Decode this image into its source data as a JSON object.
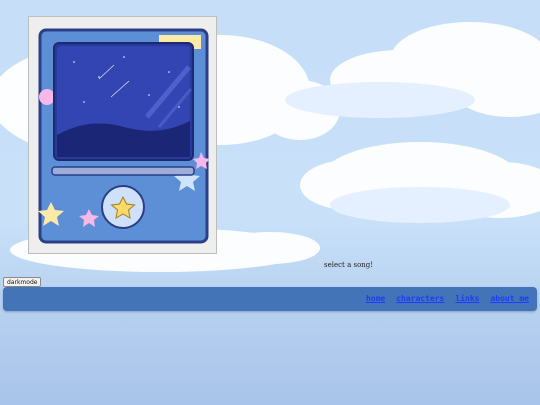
{
  "player": {
    "caption": "select a song!"
  },
  "toolbar": {
    "darkmode_label": "darkmode"
  },
  "nav": {
    "links": [
      "home",
      "characters",
      "links",
      "about me"
    ]
  },
  "colors": {
    "sky": "#c6def8",
    "cloud": "#ffffff",
    "player_shell": "#5d8fd6",
    "player_border": "#2a3f87",
    "screen_night": "#2a3a9c",
    "navbar": "#4474b8",
    "link": "#1a3cff"
  },
  "icons": [
    "star-icon",
    "play-button-icon"
  ]
}
